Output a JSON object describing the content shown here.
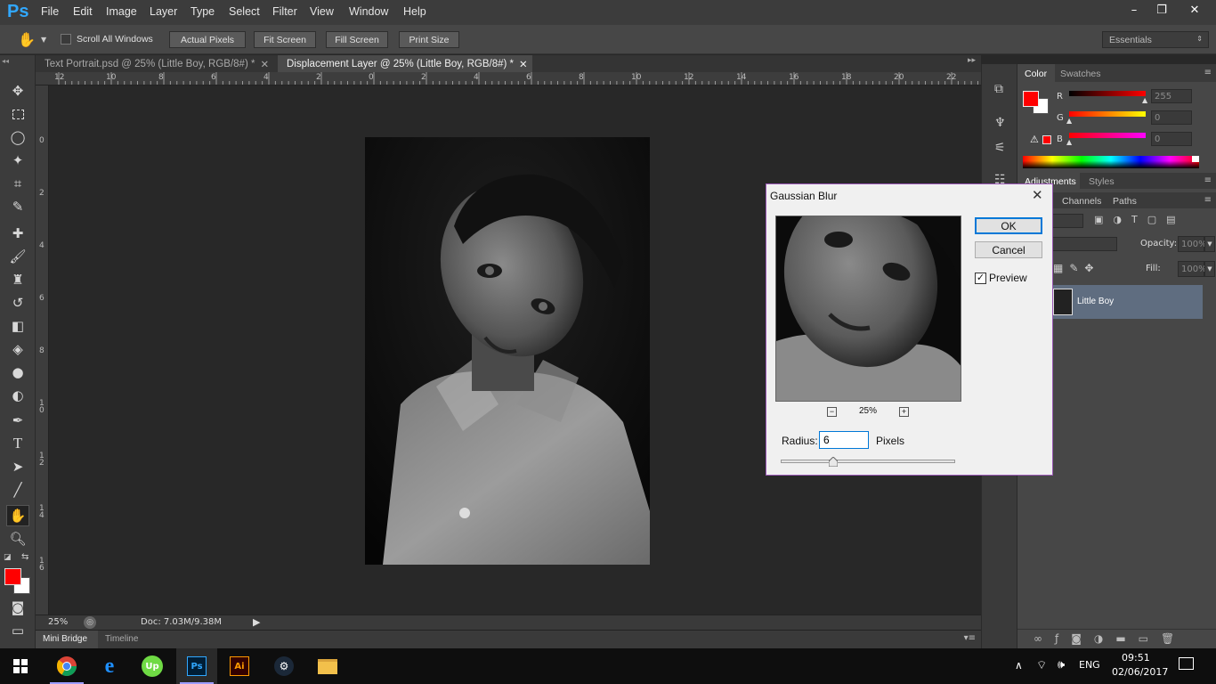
{
  "app": {
    "logo": "Ps",
    "menu": [
      "File",
      "Edit",
      "Image",
      "Layer",
      "Type",
      "Select",
      "Filter",
      "View",
      "Window",
      "Help"
    ],
    "window_controls": {
      "minimize": "–",
      "restore": "❐",
      "close": "✕"
    }
  },
  "options_bar": {
    "scroll_all_windows": "Scroll All Windows",
    "actual_pixels": "Actual Pixels",
    "fit_screen": "Fit Screen",
    "fill_screen": "Fill Screen",
    "print_size": "Print Size",
    "workspace": "Essentials"
  },
  "tabs": [
    {
      "label": "Text Portrait.psd @ 25% (Little Boy, RGB/8#) *",
      "active": false
    },
    {
      "label": "Displacement Layer @ 25% (Little Boy, RGB/8#) *",
      "active": true
    }
  ],
  "ruler": {
    "top": [
      "12",
      "10",
      "8",
      "6",
      "4",
      "2",
      "0",
      "2",
      "4",
      "6",
      "8",
      "10",
      "12",
      "14",
      "16",
      "18",
      "20",
      "22"
    ],
    "left": [
      "0",
      "2",
      "4",
      "6",
      "8",
      "10",
      "12",
      "14",
      "16"
    ]
  },
  "status": {
    "zoom": "25%",
    "doc": "Doc: 7.03M/9.38M"
  },
  "bottom_tabs": {
    "mini_bridge": "Mini Bridge",
    "timeline": "Timeline"
  },
  "color_panel": {
    "tabs": [
      "Color",
      "Swatches"
    ],
    "r_label": "R",
    "g_label": "G",
    "b_label": "B",
    "r_value": "255",
    "g_value": "0",
    "b_value": "0",
    "foreground": "#ff0000"
  },
  "adjustments_panel": {
    "tabs": [
      "Adjustments",
      "Styles"
    ]
  },
  "layers_panel": {
    "tabs": [
      "Channels",
      "Paths"
    ],
    "opacity_label": "Opacity:",
    "opacity_value": "100%",
    "fill_label": "Fill:",
    "fill_value": "100%",
    "layer_name": "Little Boy"
  },
  "dialog": {
    "title": "Gaussian Blur",
    "ok": "OK",
    "cancel": "Cancel",
    "preview_label": "Preview",
    "preview_checked": true,
    "zoom": "25%",
    "radius_label": "Radius:",
    "radius_value": "6",
    "radius_unit": "Pixels",
    "radius_slider_fraction": 0.3
  },
  "taskbar": {
    "language": "ENG",
    "time": "09:51",
    "date": "02/06/2017"
  }
}
